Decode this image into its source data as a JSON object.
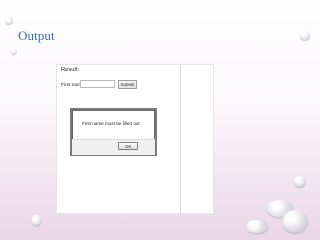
{
  "slide": {
    "title": "Output"
  },
  "app": {
    "result_label": "Result:",
    "field_label": "First name:",
    "submit_label": "Submit",
    "name_input_value": ""
  },
  "dialog": {
    "message": "First name must be filled out",
    "ok_label": "OK"
  },
  "colors": {
    "title": "#2f6fb0",
    "background_top": "#ffffff",
    "background_bottom": "#ead6e6"
  }
}
